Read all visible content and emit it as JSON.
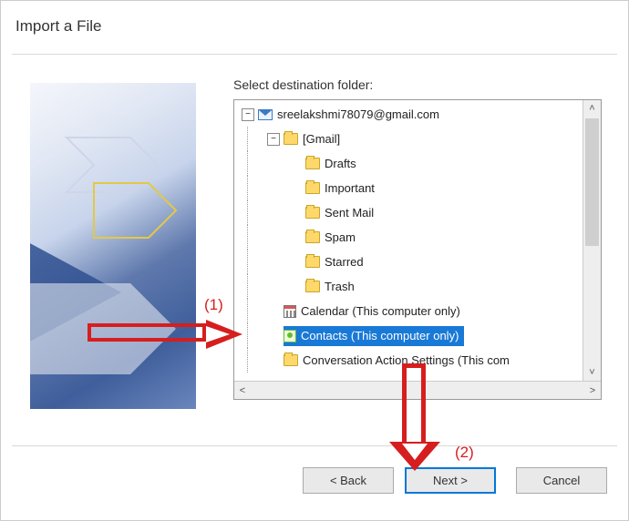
{
  "dialog": {
    "title": "Import a File",
    "label": "Select destination folder:"
  },
  "tree": {
    "account": "sreelakshmi78079@gmail.com",
    "gmail_label": "[Gmail]",
    "folders": {
      "drafts": "Drafts",
      "important": "Important",
      "sent": "Sent Mail",
      "spam": "Spam",
      "starred": "Starred",
      "trash": "Trash"
    },
    "calendar": "Calendar (This computer only)",
    "contacts": "Contacts (This computer only)",
    "conversation": "Conversation Action Settings (This com"
  },
  "buttons": {
    "back": "< Back",
    "next": "Next >",
    "cancel": "Cancel"
  },
  "annotations": {
    "one": "(1)",
    "two": "(2)"
  }
}
